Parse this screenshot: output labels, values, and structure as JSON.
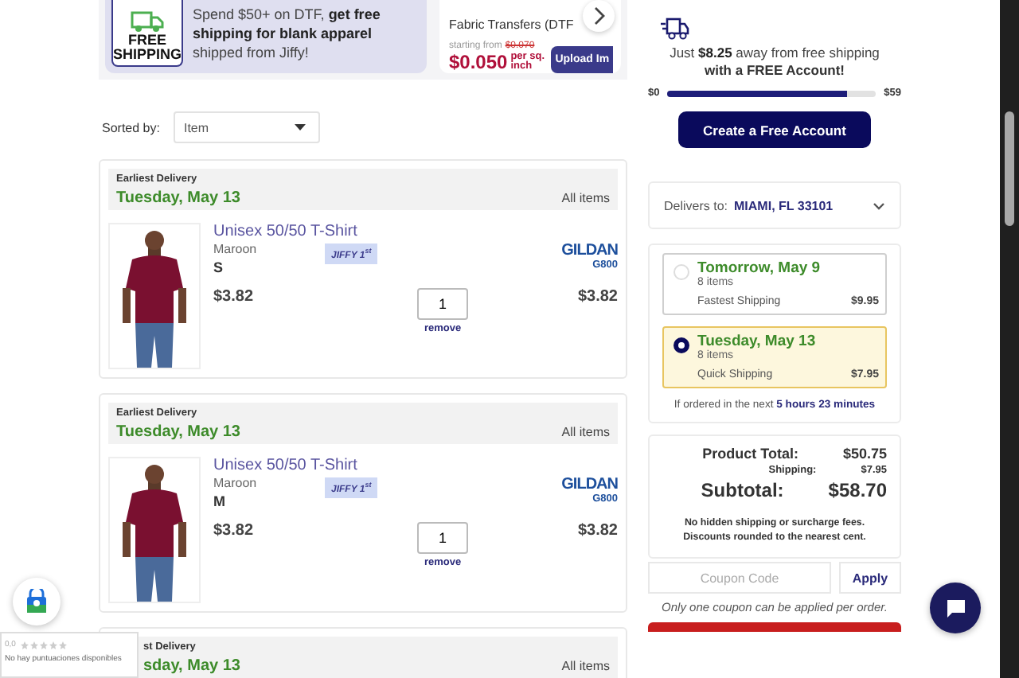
{
  "promo_banners": [
    {
      "kind": "free_shipping",
      "badge": "FREE SHIPPING",
      "text": "Spend $50+ on DTF, **get free shipping for blank apparel** shipped from Jiffy!"
    },
    {
      "kind": "product",
      "title": "Fabric Transfers (DTF",
      "price_prefix": "starting from",
      "old_price": "$0.070",
      "price": "$0.050",
      "unit": "per sq. inch",
      "button": "Upload Im"
    }
  ],
  "sort": {
    "label": "Sorted by:",
    "value": "Item"
  },
  "shipments": [
    {
      "heading": "Earliest Delivery",
      "date": "Tuesday, May 13",
      "scope": "All items",
      "item": {
        "name": "Unisex 50/50 T-Shirt",
        "variant": "Maroon",
        "size": "S",
        "badge": "JIFFY 1$^{st}$",
        "brand": "GILDAN",
        "model": "G800",
        "unit_price": "$3.82",
        "quantity": "1",
        "remove": "remove",
        "total": "$3.82"
      }
    },
    {
      "heading": "Earliest Delivery",
      "date": "Tuesday, May 13",
      "scope": "All items",
      "item": {
        "name": "Unisex 50/50 T-Shirt",
        "variant": "Maroon",
        "size": "M",
        "badge": "JIFFY 1$^{st}$",
        "brand": "GILDAN",
        "model": "G800",
        "unit_price": "$3.82",
        "quantity": "1",
        "remove": "remove",
        "total": "$3.82"
      }
    },
    {
      "heading": "st Delivery",
      "date": "sday, May 13",
      "scope": "All items"
    }
  ],
  "free_shipping": {
    "text": "Just **$8.25** away from free shipping",
    "text_2": "with a FREE Account!",
    "min": "$0",
    "max": "$59",
    "level": 0.86,
    "button": "Create a Free Account"
  },
  "delivers_to": {
    "label": "Delivers to:",
    "value": "MIAMI, FL 33101"
  },
  "shipping_options": [
    {
      "date": "Tomorrow, May 9",
      "count": "8 items",
      "method": "Fastest Shipping",
      "price": "$9.95",
      "selected": false
    },
    {
      "date": "Tuesday, May 13",
      "count": "8 items",
      "method": "Quick Shipping",
      "price": "$7.95",
      "selected": true
    }
  ],
  "cutoff": "If ordered in the next **5 hours 23 minutes**",
  "totals": [
    {
      "kind": "medium",
      "label": "Product Total:",
      "value": "$50.75"
    },
    {
      "kind": "small",
      "label": "Shipping:",
      "value": "$7.95"
    },
    {
      "kind": "large",
      "label": "Subtotal:",
      "value": "$58.70"
    }
  ],
  "totals_note": [
    "No hidden shipping or surcharge fees.",
    "Discounts rounded to the nearest cent."
  ],
  "coupon": {
    "placeholder": "Coupon Code",
    "button": "Apply",
    "note": "Only one coupon can be applied per order."
  },
  "rating_widget": {
    "score": "0,0",
    "stars": 0,
    "text": "No hay puntuaciones disponibles"
  }
}
